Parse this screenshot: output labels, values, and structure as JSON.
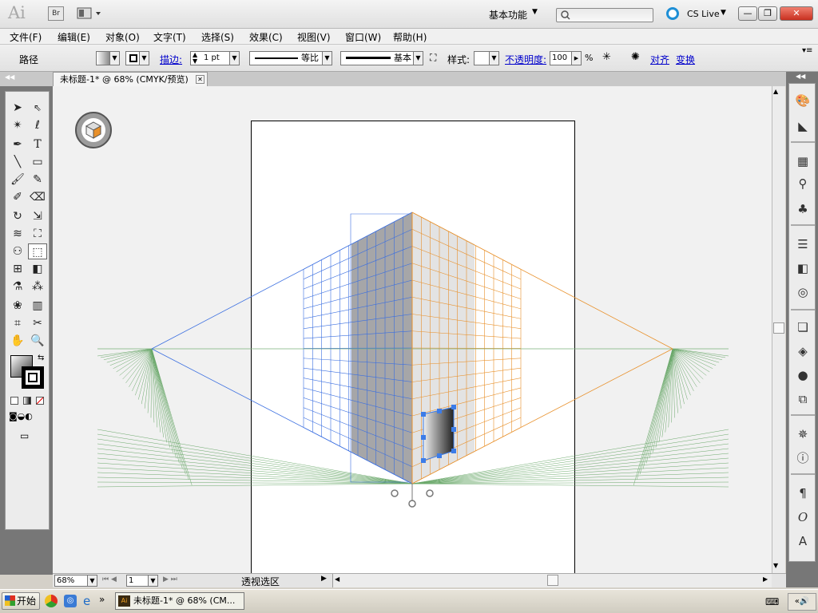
{
  "app": {
    "logo": "Ai",
    "bridge": "Br",
    "workspace": "基本功能",
    "cslive": "CS Live"
  },
  "window": {
    "minimize": "—",
    "restore": "❐",
    "close": "✕"
  },
  "menu": [
    "文件(F)",
    "编辑(E)",
    "对象(O)",
    "文字(T)",
    "选择(S)",
    "效果(C)",
    "视图(V)",
    "窗口(W)",
    "帮助(H)"
  ],
  "control": {
    "object_type": "路径",
    "stroke_label": "描边:",
    "stroke_weight": "1 pt",
    "profile": "等比",
    "brush": "基本",
    "style_label": "样式:",
    "opacity_label": "不透明度:",
    "opacity_value": "100",
    "opacity_unit": "%",
    "align": "对齐",
    "transform": "变换"
  },
  "document": {
    "tab_title": "未标题-1* @ 68% (CMYK/预览)"
  },
  "status": {
    "zoom": "68%",
    "artboard_number": "1",
    "tool_name": "透视选区"
  },
  "taskbar": {
    "start": "开始",
    "task": "未标题-1* @ 68% (CM..."
  },
  "colors": {
    "accent": "#1e8fd6",
    "left_grid": "#3a6ee0",
    "right_grid": "#e8902a",
    "ground_grid": "#6aa86a",
    "left_plane": "#a6a6a8"
  }
}
